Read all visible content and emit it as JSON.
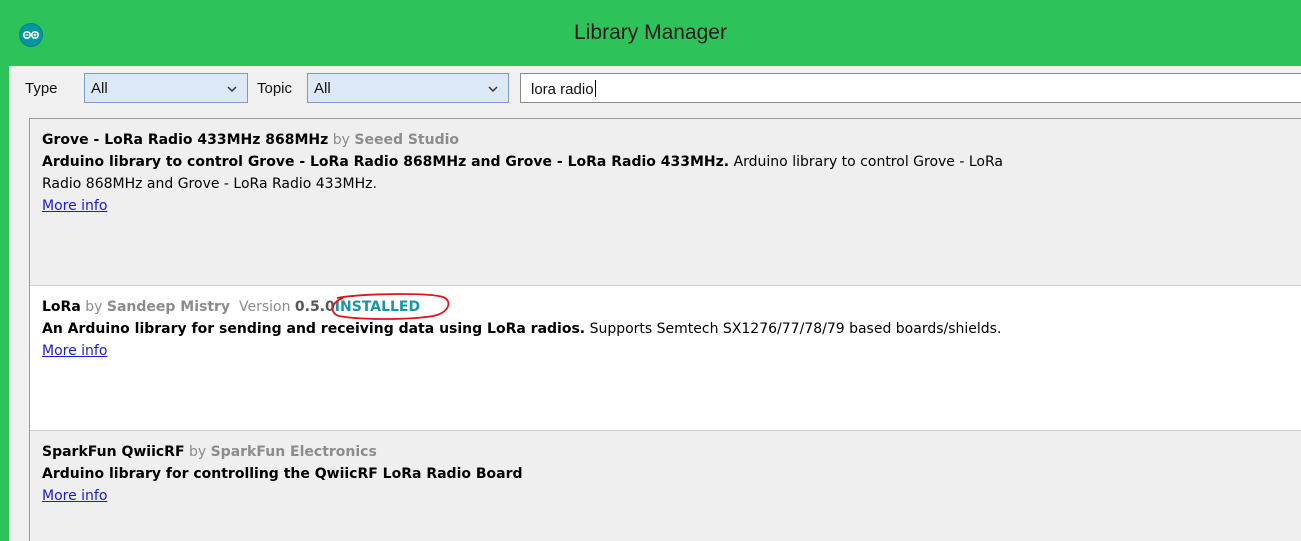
{
  "window": {
    "title": "Library Manager"
  },
  "filters": {
    "type_label": "Type",
    "type_value": "All",
    "topic_label": "Topic",
    "topic_value": "All",
    "search_value": "lora radio"
  },
  "libraries": [
    {
      "name": "Grove - LoRa Radio 433MHz 868MHz",
      "by": "by",
      "author": "Seeed Studio",
      "summary": "Arduino library to control Grove - LoRa Radio 868MHz and Grove - LoRa Radio 433MHz.",
      "description_1": "Arduino library to control Grove - LoRa",
      "description_2": "Radio 868MHz and Grove - LoRa Radio 433MHz.",
      "more_info": "More info"
    },
    {
      "name": "LoRa",
      "by": "by",
      "author": "Sandeep Mistry",
      "version_label": "Version",
      "version": "0.5.0",
      "status": "INSTALLED",
      "summary": "An Arduino library for sending and receiving data using LoRa radios.",
      "description": "Supports Semtech SX1276/77/78/79 based boards/shields.",
      "more_info": "More info"
    },
    {
      "name": "SparkFun QwiicRF",
      "by": "by",
      "author": "SparkFun Electronics",
      "summary": "Arduino library for controlling the QwiicRF LoRa Radio Board",
      "more_info": "More info"
    }
  ],
  "colors": {
    "titlebar": "#2ec35a",
    "installed_text": "#1796a3",
    "annotation_circle": "#e0141e",
    "link": "#1a1ad6"
  }
}
